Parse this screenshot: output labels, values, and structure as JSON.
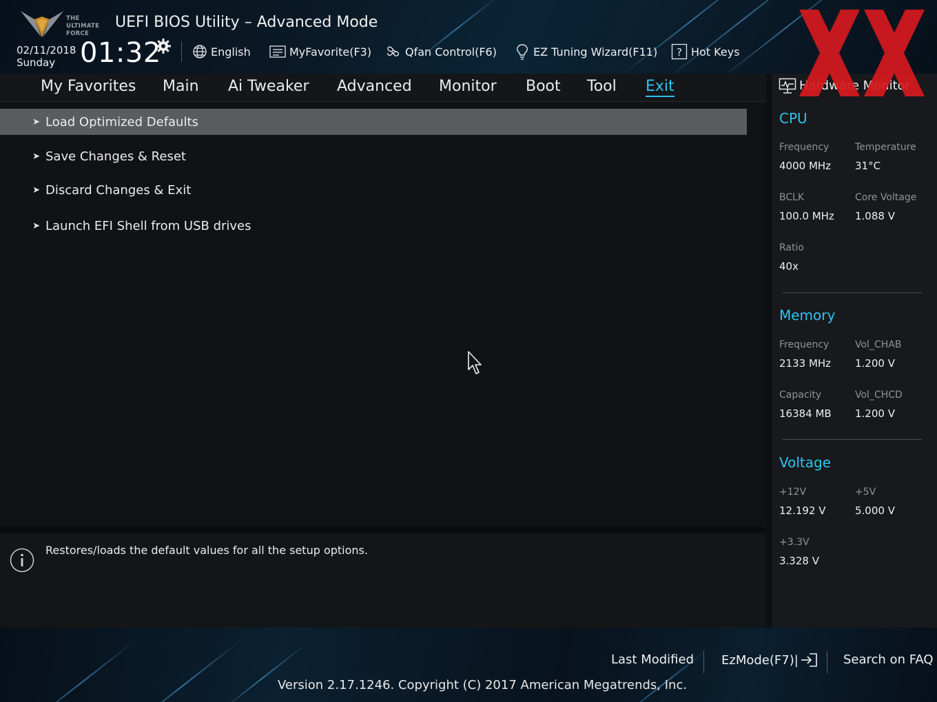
{
  "header": {
    "logo_text": [
      "THE",
      "ULTIMATE",
      "FORCE"
    ],
    "title": "UEFI BIOS Utility – Advanced Mode",
    "date": "02/11/2018",
    "day": "Sunday",
    "time": "01:32",
    "items": [
      {
        "label": "English",
        "icon": "globe-icon"
      },
      {
        "label": "MyFavorite(F3)",
        "icon": "favorite-list-icon"
      },
      {
        "label": "Qfan Control(F6)",
        "icon": "fan-icon"
      },
      {
        "label": "EZ Tuning Wizard(F11)",
        "icon": "lightbulb-icon"
      },
      {
        "label": "Hot Keys",
        "icon": "question-box-icon"
      }
    ]
  },
  "tabs": [
    {
      "label": "My Favorites"
    },
    {
      "label": "Main"
    },
    {
      "label": "Ai Tweaker"
    },
    {
      "label": "Advanced"
    },
    {
      "label": "Monitor"
    },
    {
      "label": "Boot"
    },
    {
      "label": "Tool"
    },
    {
      "label": "Exit",
      "active": true
    }
  ],
  "menu": [
    {
      "label": "Load Optimized Defaults",
      "selected": true
    },
    {
      "label": "Save Changes & Reset"
    },
    {
      "label": "Discard Changes & Exit"
    },
    {
      "label": "Launch EFI Shell from USB drives"
    }
  ],
  "help_text": "Restores/loads the default values for all the setup options.",
  "hardware_monitor": {
    "title": "Hardware Monitor",
    "cpu": {
      "title": "CPU",
      "frequency_label": "Frequency",
      "frequency": "4000 MHz",
      "temperature_label": "Temperature",
      "temperature": "31°C",
      "bclk_label": "BCLK",
      "bclk": "100.0 MHz",
      "core_voltage_label": "Core Voltage",
      "core_voltage": "1.088 V",
      "ratio_label": "Ratio",
      "ratio": "40x"
    },
    "memory": {
      "title": "Memory",
      "frequency_label": "Frequency",
      "frequency": "2133 MHz",
      "vol_chab_label": "Vol_CHAB",
      "vol_chab": "1.200 V",
      "capacity_label": "Capacity",
      "capacity": "16384 MB",
      "vol_chcd_label": "Vol_CHCD",
      "vol_chcd": "1.200 V"
    },
    "voltage": {
      "title": "Voltage",
      "v12_label": "+12V",
      "v12": "12.192 V",
      "v5_label": "+5V",
      "v5": "5.000 V",
      "v33_label": "+3.3V",
      "v33": "3.328 V"
    }
  },
  "footer": {
    "last_modified": "Last Modified",
    "ezmode": "EzMode(F7)|",
    "search_faq": "Search on FAQ",
    "version": "Version 2.17.1246. Copyright (C) 2017 American Megatrends, Inc."
  },
  "colors": {
    "accent": "#2fc3ef",
    "selected_row": "#5b5c5f",
    "brand_red": "#d7191f"
  }
}
